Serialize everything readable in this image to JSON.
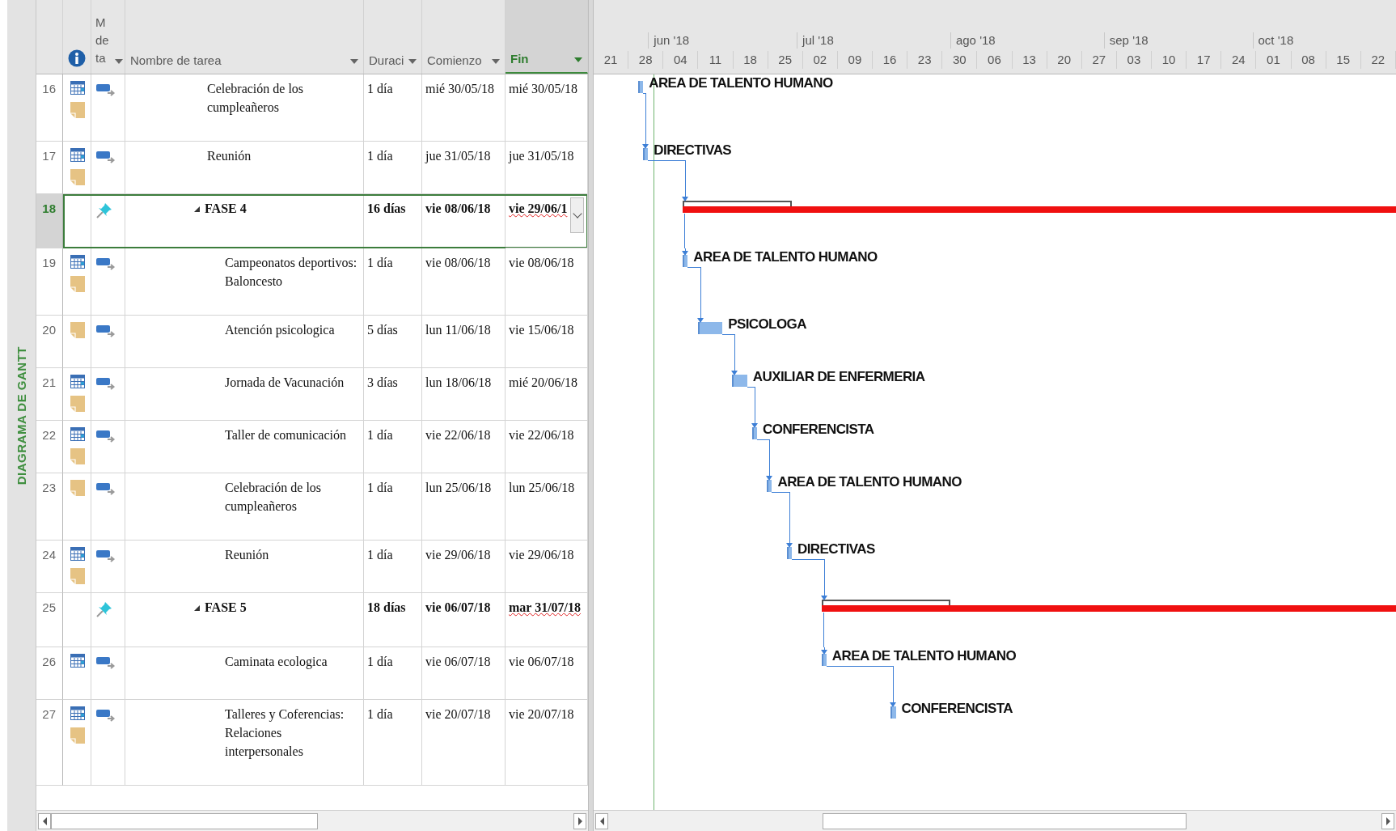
{
  "side_label": "DIAGRAMA DE GANTT",
  "header": {
    "mode": "M de ta",
    "columns": [
      {
        "label": "Nombre de tarea",
        "selected": false
      },
      {
        "label": "Duraci",
        "selected": false
      },
      {
        "label": "Comienzo",
        "selected": false
      },
      {
        "label": "Fin",
        "selected": true
      }
    ]
  },
  "timescale": {
    "months": [
      "jun '18",
      "jul '18",
      "ago '18",
      "sep '18",
      "oct '18"
    ],
    "weeks": [
      "21",
      "28",
      "04",
      "11",
      "18",
      "25",
      "02",
      "09",
      "16",
      "23",
      "30",
      "06",
      "13",
      "20",
      "27",
      "03",
      "10",
      "17",
      "24",
      "01",
      "08",
      "15",
      "22"
    ]
  },
  "rows": [
    {
      "id": "16",
      "indicators": [
        {
          "kind": "calendar"
        },
        {
          "kind": "note"
        }
      ],
      "mode_icon": {
        "kind": "auto"
      },
      "name": "Celebración de los cumpleañeros",
      "duration": "1 día",
      "start": "mié 30/05/18",
      "finish": "mié 30/05/18",
      "selected": false,
      "spell_error": false,
      "resource": "AREA DE TALENTO HUMANO"
    },
    {
      "id": "17",
      "indicators": [
        {
          "kind": "calendar"
        },
        {
          "kind": "note"
        }
      ],
      "mode_icon": {
        "kind": "auto"
      },
      "name": "Reunión",
      "duration": "1 día",
      "start": "jue 31/05/18",
      "finish": "jue 31/05/18",
      "selected": false,
      "spell_error": false,
      "resource": "DIRECTIVAS"
    },
    {
      "id": "18",
      "mode_icon": {
        "kind": "manual"
      },
      "name": "FASE 4",
      "expanded": true,
      "duration": "16 días",
      "start": "vie 08/06/18",
      "finish": "vie 29/06/1",
      "selected": true,
      "spell_error": true,
      "children": [
        {
          "id": "19",
          "indicators": [
            {
              "kind": "calendar"
            },
            {
              "kind": "note"
            }
          ],
          "mode_icon": {
            "kind": "auto"
          },
          "name": "Campeonatos deportivos: Baloncesto",
          "duration": "1 día",
          "start": "vie 08/06/18",
          "finish": "vie 08/06/18",
          "selected": false,
          "spell_error": false,
          "resource": "AREA DE TALENTO HUMANO"
        },
        {
          "id": "20",
          "indicators": [
            {
              "kind": "note"
            }
          ],
          "mode_icon": {
            "kind": "auto"
          },
          "name": "Atención psicologica",
          "duration": "5 días",
          "start": "lun 11/06/18",
          "finish": "vie 15/06/18",
          "selected": false,
          "spell_error": false,
          "resource": "PSICOLOGA"
        },
        {
          "id": "21",
          "indicators": [
            {
              "kind": "calendar"
            },
            {
              "kind": "note"
            }
          ],
          "mode_icon": {
            "kind": "auto"
          },
          "name": "Jornada de Vacunación",
          "duration": "3 días",
          "start": "lun 18/06/18",
          "finish": "mié 20/06/18",
          "selected": false,
          "spell_error": false,
          "resource": "AUXILIAR DE ENFERMERIA"
        },
        {
          "id": "22",
          "indicators": [
            {
              "kind": "calendar"
            },
            {
              "kind": "note"
            }
          ],
          "mode_icon": {
            "kind": "auto"
          },
          "name": "Taller de comunicación",
          "duration": "1 día",
          "start": "vie 22/06/18",
          "finish": "vie 22/06/18",
          "selected": false,
          "spell_error": false,
          "resource": "CONFERENCISTA"
        },
        {
          "id": "23",
          "indicators": [
            {
              "kind": "note"
            }
          ],
          "mode_icon": {
            "kind": "auto"
          },
          "name": "Celebración de los cumpleañeros",
          "duration": "1 día",
          "start": "lun 25/06/18",
          "finish": "lun 25/06/18",
          "selected": false,
          "spell_error": false,
          "resource": "AREA DE TALENTO HUMANO"
        },
        {
          "id": "24",
          "indicators": [
            {
              "kind": "calendar"
            },
            {
              "kind": "note"
            }
          ],
          "mode_icon": {
            "kind": "auto"
          },
          "name": "Reunión",
          "duration": "1 día",
          "start": "vie 29/06/18",
          "finish": "vie 29/06/18",
          "selected": false,
          "spell_error": false,
          "resource": "DIRECTIVAS"
        }
      ]
    },
    {
      "id": "25",
      "mode_icon": {
        "kind": "manual"
      },
      "name": "FASE 5",
      "expanded": true,
      "duration": "18 días",
      "start": "vie 06/07/18",
      "finish": "mar 31/07/18",
      "selected": false,
      "spell_error": true,
      "children": [
        {
          "id": "26",
          "indicators": [
            {
              "kind": "calendar"
            }
          ],
          "mode_icon": {
            "kind": "auto"
          },
          "name": "Caminata ecologica",
          "duration": "1 día",
          "start": "vie 06/07/18",
          "finish": "vie 06/07/18",
          "selected": false,
          "spell_error": false,
          "resource": "AREA DE TALENTO HUMANO"
        },
        {
          "id": "27",
          "indicators": [
            {
              "kind": "calendar"
            },
            {
              "kind": "note"
            }
          ],
          "mode_icon": {
            "kind": "auto"
          },
          "name": "Talleres y Coferencias: Relaciones interpersonales",
          "duration": "1 día",
          "start": "vie 20/07/18",
          "finish": "vie 20/07/18",
          "selected": false,
          "spell_error": false,
          "resource": "CONFERENCISTA"
        }
      ]
    }
  ]
}
